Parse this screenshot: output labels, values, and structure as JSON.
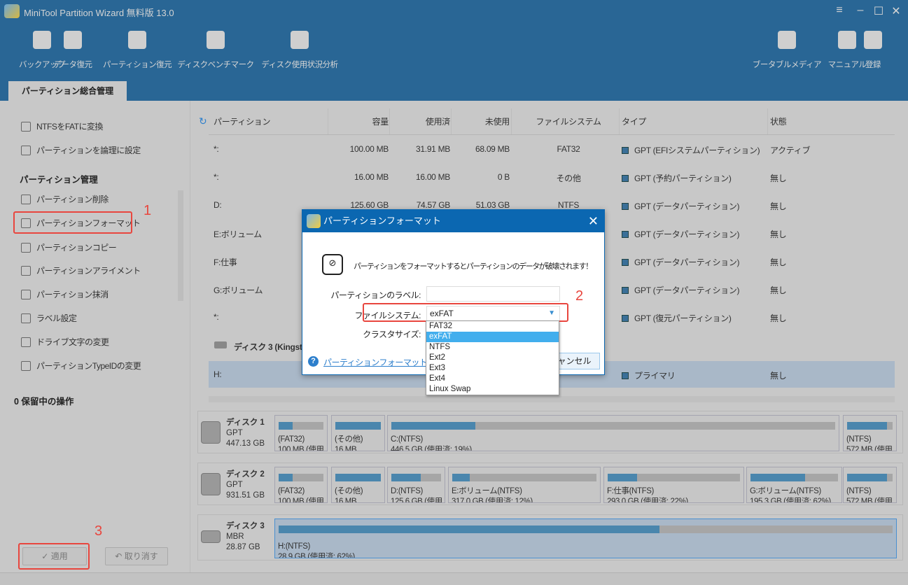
{
  "app": {
    "title": "MiniTool Partition Wizard 無料版 13.0"
  },
  "toolbar": {
    "left": [
      {
        "label": "バックアップ",
        "icon": "backup-icon"
      },
      {
        "label": "データ復元",
        "icon": "data-recovery-icon"
      },
      {
        "label": "パーティション復元",
        "icon": "partition-recovery-icon"
      },
      {
        "label": "ディスクベンチマーク",
        "icon": "disk-benchmark-icon"
      },
      {
        "label": "ディスク使用状況分析",
        "icon": "space-analyzer-icon"
      }
    ],
    "right": [
      {
        "label": "ブータブルメディア",
        "icon": "bootable-media-icon"
      },
      {
        "label": "マニュアル",
        "icon": "manual-icon"
      },
      {
        "label": "登録",
        "icon": "register-icon"
      }
    ]
  },
  "tab": "パーティション総合管理",
  "sidebar": {
    "items_top": [
      "NTFSをFATに変換",
      "パーティションを論理に設定"
    ],
    "section": "パーティション管理",
    "items": [
      "パーティション削除",
      "パーティションフォーマット",
      "パーティションコピー",
      "パーティションアライメント",
      "パーティション抹消",
      "ラベル設定",
      "ドライブ文字の変更",
      "パーティションTypeIDの変更"
    ],
    "pending": "0 保留中の操作",
    "apply": "適用",
    "undo": "取り消す"
  },
  "annotations": {
    "step1": "1",
    "step2": "2",
    "step3": "3"
  },
  "table": {
    "headers": [
      "パーティション",
      "容量",
      "使用済",
      "未使用",
      "ファイルシステム",
      "タイプ",
      "状態"
    ],
    "rows": [
      [
        "*:",
        "100.00 MB",
        "31.91 MB",
        "68.09 MB",
        "FAT32",
        "GPT (EFIシステムパーティション)",
        "アクティブ"
      ],
      [
        "*:",
        "16.00 MB",
        "16.00 MB",
        "0 B",
        "その他",
        "GPT (予約パーティション)",
        "無し"
      ],
      [
        "D:",
        "125.60 GB",
        "74.57 GB",
        "51.03 GB",
        "NTFS",
        "GPT (データパーティション)",
        "無し"
      ],
      [
        "E:ボリューム",
        "",
        "",
        "",
        "",
        "GPT (データパーティション)",
        "無し"
      ],
      [
        "F:仕事",
        "",
        "",
        "",
        "",
        "GPT (データパーティション)",
        "無し"
      ],
      [
        "G:ボリューム",
        "",
        "",
        "",
        "",
        "GPT (データパーティション)",
        "無し"
      ],
      [
        "*:",
        "",
        "",
        "",
        "",
        "GPT (復元パーティション)",
        "無し"
      ]
    ],
    "disk3_header": "ディスク 3 (Kingsto",
    "selected_row": [
      "H:",
      "",
      "",
      "",
      "",
      "プライマリ",
      "無し"
    ]
  },
  "disks": [
    {
      "name": "ディスク 1",
      "type": "GPT",
      "size": "447.13 GB",
      "parts": [
        {
          "l1": "(FAT32)",
          "l2": "100 MB (使用",
          "used": 32
        },
        {
          "l1": "(その他)",
          "l2": "16 MB",
          "used": 100
        },
        {
          "l1": "C:(NTFS)",
          "l2": "446.5 GB (使用済: 19%)",
          "used": 19
        },
        {
          "l1": "(NTFS)",
          "l2": "572 MB (使用",
          "used": 88
        }
      ]
    },
    {
      "name": "ディスク 2",
      "type": "GPT",
      "size": "931.51 GB",
      "parts": [
        {
          "l1": "(FAT32)",
          "l2": "100 MB (使用",
          "used": 32
        },
        {
          "l1": "(その他)",
          "l2": "16 MB",
          "used": 100
        },
        {
          "l1": "D:(NTFS)",
          "l2": "125.6 GB (使用",
          "used": 59
        },
        {
          "l1": "E:ボリューム(NTFS)",
          "l2": "317.0 GB (使用済: 12%)",
          "used": 12
        },
        {
          "l1": "F:仕事(NTFS)",
          "l2": "293.0 GB (使用済: 22%)",
          "used": 22
        },
        {
          "l1": "G:ボリューム(NTFS)",
          "l2": "195.3 GB (使用済: 62%)",
          "used": 62
        },
        {
          "l1": "(NTFS)",
          "l2": "572 MB (使用",
          "used": 88
        }
      ]
    },
    {
      "name": "ディスク 3",
      "type": "MBR",
      "size": "28.87 GB",
      "parts": [
        {
          "l1": "H:(NTFS)",
          "l2": "28.9 GB (使用済: 62%)",
          "used": 62
        }
      ]
    }
  ],
  "dialog": {
    "title": "パーティションフォーマット",
    "warning": "パーティションをフォーマットするとパーティションのデータが破壊されます！",
    "label_label": "パーティションのラベル:",
    "label_value": "",
    "fs_label": "ファイルシステム:",
    "fs_value": "exFAT",
    "cluster_label": "クラスタサイズ:",
    "help_link": "パーティションフォーマットのチュー",
    "cancel": "キャンセル",
    "fs_options": [
      "FAT32",
      "exFAT",
      "NTFS",
      "Ext2",
      "Ext3",
      "Ext4",
      "Linux Swap"
    ],
    "fs_selected_index": 1
  },
  "colors": {
    "accent": "#296695",
    "dialog_title": "#0b67b1",
    "selection": "#42aeed",
    "annotation": "#e8463e",
    "used_bar": "#4a86ad"
  }
}
